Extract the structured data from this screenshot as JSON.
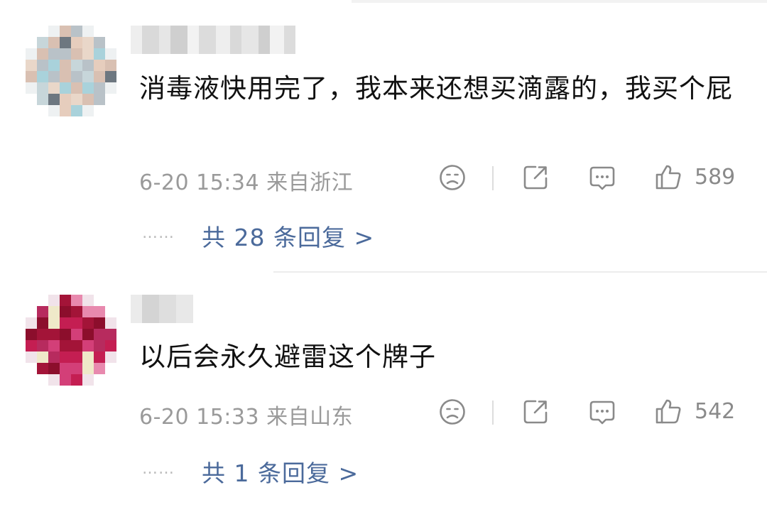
{
  "comments": [
    {
      "text": "消毒液快用完了，我本来还想买滴露的，我买个屁",
      "time": "6-20 15:34",
      "location": "来自浙江",
      "likes": "589",
      "replies": "共 28 条回复 >",
      "dots": "……"
    },
    {
      "text": "以后会永久避雷这个牌子",
      "time": "6-20 15:33",
      "location": "来自山东",
      "likes": "542",
      "replies": "共 1 条回复 >",
      "dots": "……"
    }
  ],
  "icons": [
    "dislike-face-icon",
    "share-icon",
    "comment-icon",
    "thumbs-up-icon"
  ],
  "colors": {
    "reply_link": "#4b6a9b",
    "meta_gray": "#9a9a9a",
    "text": "#111111"
  }
}
